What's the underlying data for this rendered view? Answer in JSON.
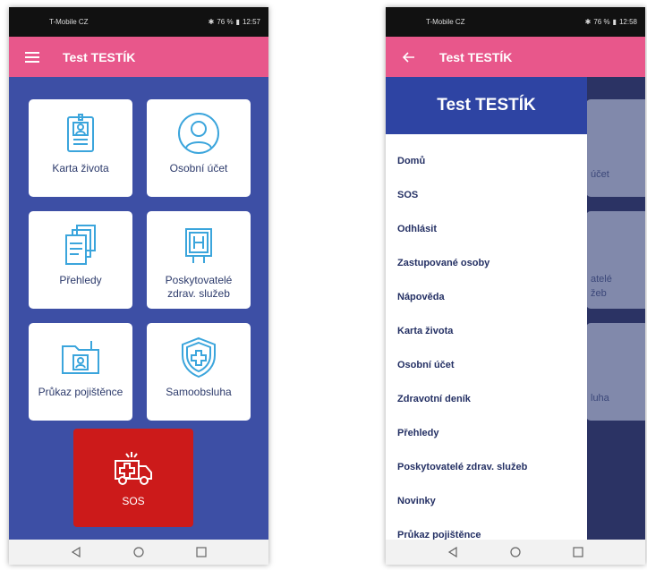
{
  "left_screen": {
    "status": {
      "carrier": "T-Mobile CZ",
      "battery": "76 %",
      "time": "12:57"
    },
    "app_bar": {
      "title": "Test TESTÍK",
      "menu_icon": "hamburger-icon"
    },
    "tiles": [
      {
        "label": "Karta života",
        "icon": "id-card-icon"
      },
      {
        "label": "Osobní účet",
        "icon": "user-avatar-icon"
      },
      {
        "label": "Přehledy",
        "icon": "documents-icon"
      },
      {
        "label": "Poskytovatelé zdrav. služeb",
        "icon": "hospital-sign-icon"
      },
      {
        "label": "Průkaz pojištěnce",
        "icon": "insurance-card-icon"
      },
      {
        "label": "Samoobsluha",
        "icon": "shield-plus-icon"
      }
    ],
    "sos": {
      "label": "SOS",
      "icon": "ambulance-icon"
    },
    "colors": {
      "app_bar": "#e8578b",
      "background": "#3d4fa5",
      "sos": "#cc1a1a"
    }
  },
  "right_screen": {
    "status": {
      "carrier": "T-Mobile CZ",
      "battery": "76 %",
      "time": "12:58"
    },
    "app_bar": {
      "title": "Test TESTÍK",
      "back_icon": "arrow-left-icon"
    },
    "drawer": {
      "header": "Test TESTÍK",
      "items": [
        "Domů",
        "SOS",
        "Odhlásit",
        "Zastupované osoby",
        "Nápověda",
        "Karta života",
        "Osobní účet",
        "Zdravotní deník",
        "Přehledy",
        "Poskytovatelé zdrav. služeb",
        "Novinky",
        "Průkaz pojištěnce"
      ]
    },
    "background_labels": [
      "účet",
      "atelé",
      "žeb",
      "luha"
    ]
  }
}
